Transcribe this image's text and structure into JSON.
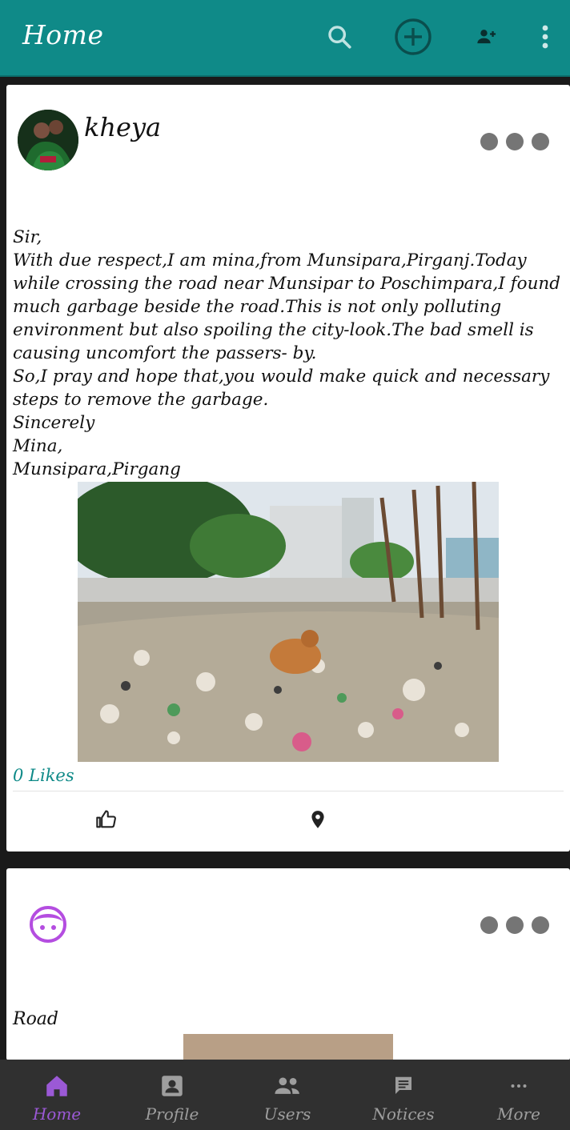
{
  "appbar": {
    "title": "Home",
    "icons": [
      "search-icon",
      "add-circle-icon",
      "add-user-icon",
      "more-vert-icon"
    ],
    "color": "#0f8a88"
  },
  "posts": [
    {
      "username": "kheya",
      "body": "Sir,\nWith due respect,I am mina,from Munsipara,Pirganj.Today while crossing the road near Munsipar to Poschimpara,I found much garbage beside the road.This is not only polluting environment but also spoiling the city-look.The bad smell is causing uncomfort the passers- by.\nSo,I pray and hope that,you would make quick and necessary steps to remove the garbage.\nSincerely\nMina,\nMunsipara,Pirgang",
      "likes": "0 Likes"
    },
    {
      "username": "",
      "body": "Road"
    }
  ],
  "bottom_nav": [
    {
      "label": "Home",
      "icon": "home-icon",
      "active": true
    },
    {
      "label": "Profile",
      "icon": "profile-icon",
      "active": false
    },
    {
      "label": "Users",
      "icon": "users-icon",
      "active": false
    },
    {
      "label": "Notices",
      "icon": "notices-icon",
      "active": false
    },
    {
      "label": "More",
      "icon": "more-horiz-icon",
      "active": false
    }
  ],
  "colors": {
    "accent": "#0f8a88",
    "nav_active": "#9b59d6",
    "nav_inactive": "#9e9e9e"
  }
}
